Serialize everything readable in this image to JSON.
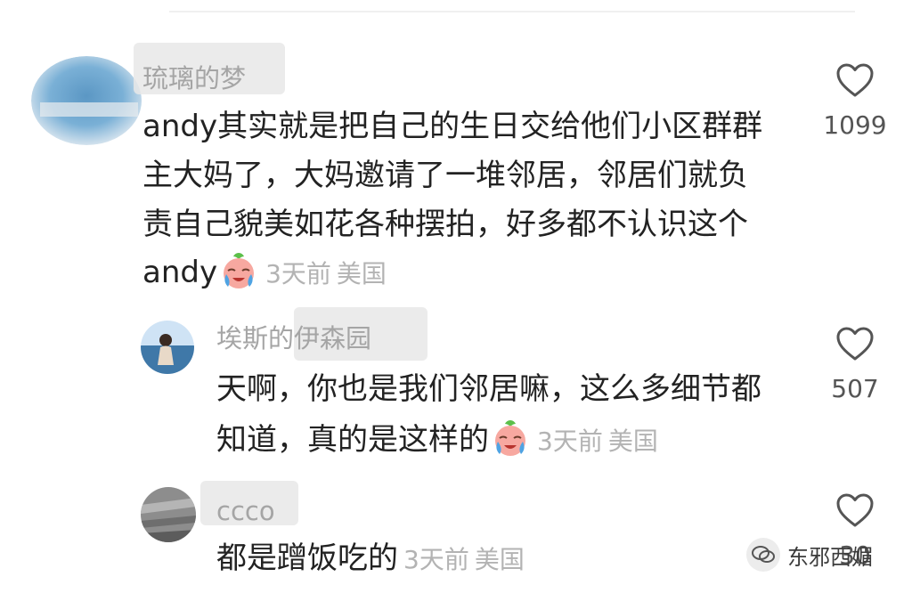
{
  "comments": [
    {
      "username": "琉璃的梦",
      "lines": [
        "andy其实就是把自己的生日交给他们小区群群",
        "主大妈了，大妈邀请了一堆邻居，邻居们就负",
        "责自己貌美如花各种摆拍，好多都不认识这个",
        "andy"
      ],
      "emoji": "crying-face-emoji",
      "time": "3天前",
      "location": "美国",
      "likes": "1099"
    },
    {
      "username": "埃斯的伊森园",
      "lines": [
        "天啊，你也是我们邻居嘛，这么多细节都",
        "知道，真的是这样的"
      ],
      "emoji": "crying-face-emoji",
      "time": "3天前",
      "location": "美国",
      "likes": "507"
    },
    {
      "username": "ccco",
      "lines": [
        "都是蹭饭吃的"
      ],
      "time": "3天前",
      "location": "美国",
      "likes": "30"
    }
  ],
  "watermark": {
    "text": "东邪西媚",
    "icon": "wechat-official-account-icon"
  },
  "colors": {
    "text": "#222222",
    "meta": "#b3b3b3",
    "username": "#a5a5a5",
    "like_outline": "#555555"
  }
}
